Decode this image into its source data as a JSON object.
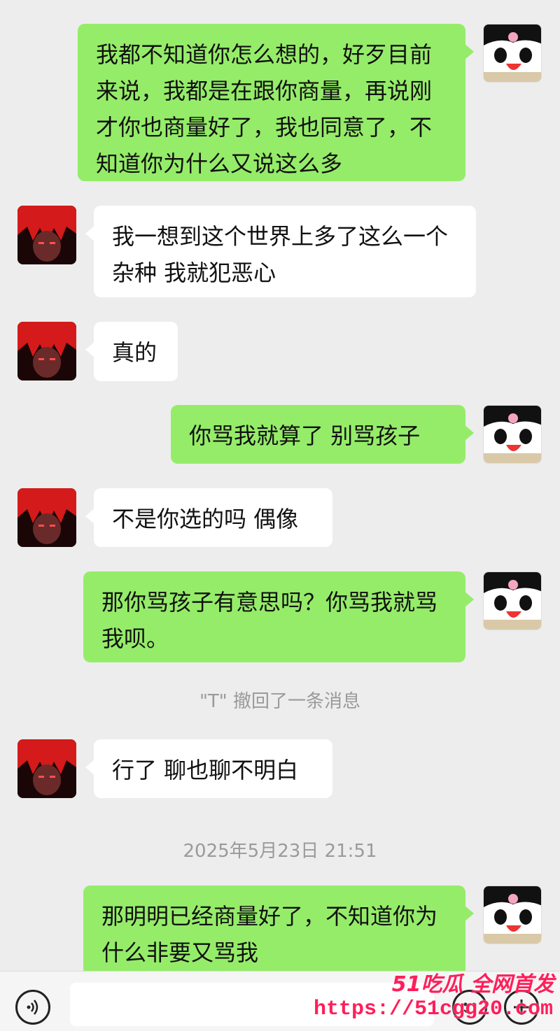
{
  "colors": {
    "background": "#ededed",
    "bubble_me": "#95ec69",
    "bubble_other": "#ffffff",
    "system_text": "#9a9a9a",
    "watermark": "#ff1e5a"
  },
  "messages": [
    {
      "side": "me",
      "avatar": "panda-avatar",
      "text": "我都不知道你怎么想的，好歹目前来说，我都是在跟你商量，再说刚才你也商量好了，我也同意了，不知道你为什么又说这么多"
    },
    {
      "side": "other",
      "avatar": "red-hair-avatar",
      "text": "我一想到这个世界上多了这么一个杂种 我就犯恶心"
    },
    {
      "side": "other",
      "avatar": "red-hair-avatar",
      "text": "真的"
    },
    {
      "side": "me",
      "avatar": "panda-avatar",
      "text": "你骂我就算了 别骂孩子"
    },
    {
      "side": "other",
      "avatar": "red-hair-avatar",
      "text": "不是你选的吗 偶像"
    },
    {
      "side": "me",
      "avatar": "panda-avatar",
      "text": "那你骂孩子有意思吗？你骂我就骂我呗。"
    },
    {
      "side": "system",
      "text": "\"T\" 撤回了一条消息"
    },
    {
      "side": "other",
      "avatar": "red-hair-avatar",
      "text": "行了 聊也聊不明白"
    },
    {
      "side": "system",
      "text": "2025年5月23日 21:51"
    },
    {
      "side": "me",
      "avatar": "panda-avatar",
      "text": "那明明已经商量好了，不知道你为什么非要又骂我"
    }
  ],
  "watermark": {
    "line1": "51吃瓜 全网首发",
    "line2": "https://51cgg20.com"
  }
}
